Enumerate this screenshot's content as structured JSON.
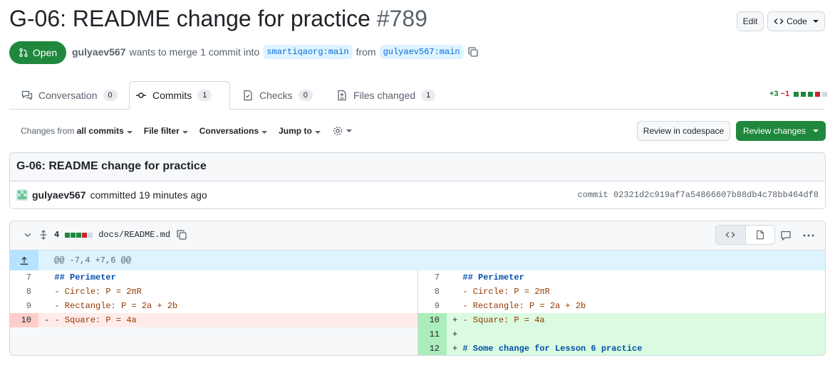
{
  "header": {
    "title": "G-06: README change for practice",
    "number": "#789",
    "edit_label": "Edit",
    "code_label": "Code"
  },
  "pr_meta": {
    "status": "Open",
    "author": "gulyaev567",
    "text_mid": "wants to merge 1 commit into",
    "base_branch": "smartiqaorg:main",
    "text_from": "from",
    "head_branch": "gulyaev567:main"
  },
  "tabs": [
    {
      "label": "Conversation",
      "count": "0",
      "icon": "comment-discussion-icon"
    },
    {
      "label": "Commits",
      "count": "1",
      "icon": "git-commit-icon"
    },
    {
      "label": "Checks",
      "count": "0",
      "icon": "checklist-icon"
    },
    {
      "label": "Files changed",
      "count": "1",
      "icon": "file-diff-icon"
    }
  ],
  "diffstat": {
    "additions": "+3",
    "deletions": "−1"
  },
  "toolbar": {
    "changes_prefix": "Changes from",
    "changes_value": "all commits",
    "file_filter": "File filter",
    "conversations": "Conversations",
    "jump_to": "Jump to",
    "review_codespace": "Review in codespace",
    "review_changes": "Review changes"
  },
  "commit": {
    "title": "G-06: README change for practice",
    "author": "gulyaev567",
    "action": "committed 19 minutes ago",
    "sha_label": "commit 02321d2c919af7a54866607b88db4c78bb464df8"
  },
  "file": {
    "changes": "4",
    "path": "docs/README.md",
    "hunk": "@@ -7,4 +7,6 @@",
    "left_lines": [
      {
        "num": "7",
        "marker": " ",
        "text": "## Perimeter"
      },
      {
        "num": "8",
        "marker": " ",
        "text": "- Circle: P = 2πR"
      },
      {
        "num": "9",
        "marker": " ",
        "text": "- Rectangle: P = 2a + 2b"
      },
      {
        "num": "10",
        "marker": "-",
        "text": "- Square: P = 4a"
      }
    ],
    "right_lines": [
      {
        "num": "7",
        "marker": " ",
        "text": "## Perimeter"
      },
      {
        "num": "8",
        "marker": " ",
        "text": "- Circle: P = 2πR"
      },
      {
        "num": "9",
        "marker": " ",
        "text": "- Rectangle: P = 2a + 2b"
      },
      {
        "num": "10",
        "marker": "+",
        "text": "- Square: P = 4a"
      },
      {
        "num": "11",
        "marker": "+",
        "text": ""
      },
      {
        "num": "12",
        "marker": "+",
        "text": "# Some change for Lesson 6 practice"
      }
    ]
  },
  "colors": {
    "green": "#1f883d",
    "red": "#cf222e",
    "accent": "#0969da"
  }
}
